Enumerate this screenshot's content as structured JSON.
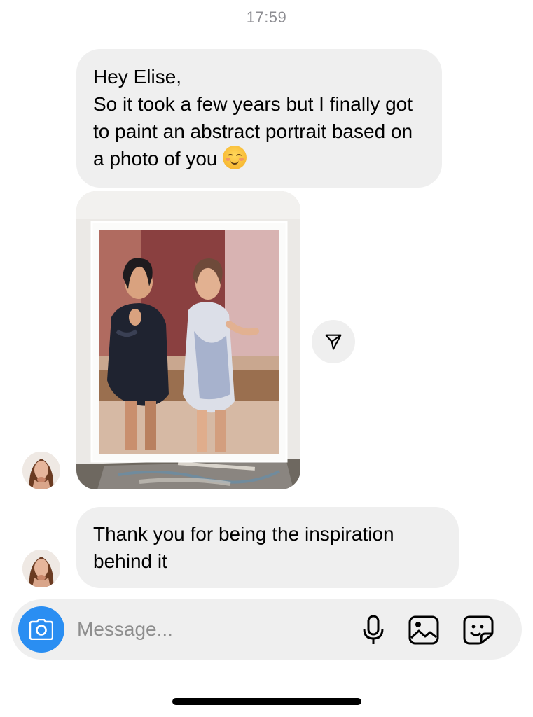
{
  "header": {
    "timestamp": "17:59"
  },
  "messages": [
    {
      "type": "text",
      "text": "Hey Elise,\nSo it took a few years but I finally got to paint an abstract portrait based on a photo of you",
      "emoji": "smiling-face-emoji"
    },
    {
      "type": "image",
      "description_icon": "painting-photo"
    },
    {
      "type": "text",
      "text": "Thank you for being the inspiration behind it"
    }
  ],
  "composer": {
    "placeholder": "Message...",
    "icons": [
      "camera-icon",
      "microphone-icon",
      "gallery-icon",
      "sticker-icon"
    ]
  },
  "colors": {
    "bubble": "#efefef",
    "accent": "#2a8ef2",
    "timestamp": "#8e8e93",
    "placeholder": "#8e8e8e"
  }
}
